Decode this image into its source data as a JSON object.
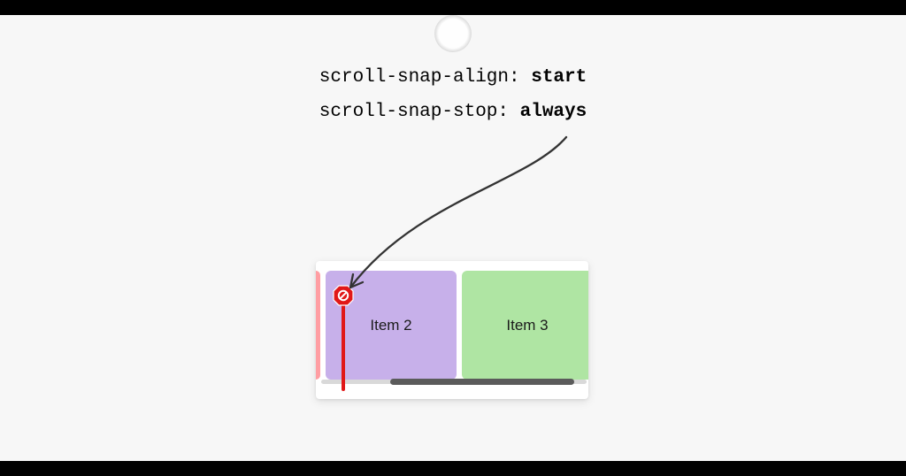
{
  "code": {
    "line1_prop": "scroll-snap-align: ",
    "line1_val": "start",
    "line2_prop": "scroll-snap-stop: ",
    "line2_val": "always"
  },
  "items": {
    "i1": "",
    "i2": "Item 2",
    "i3": "Item 3"
  },
  "colors": {
    "purple": "#c7b0ea",
    "green": "#afe5a3",
    "pink": "#ff9ea3",
    "stop": "#e11818"
  }
}
